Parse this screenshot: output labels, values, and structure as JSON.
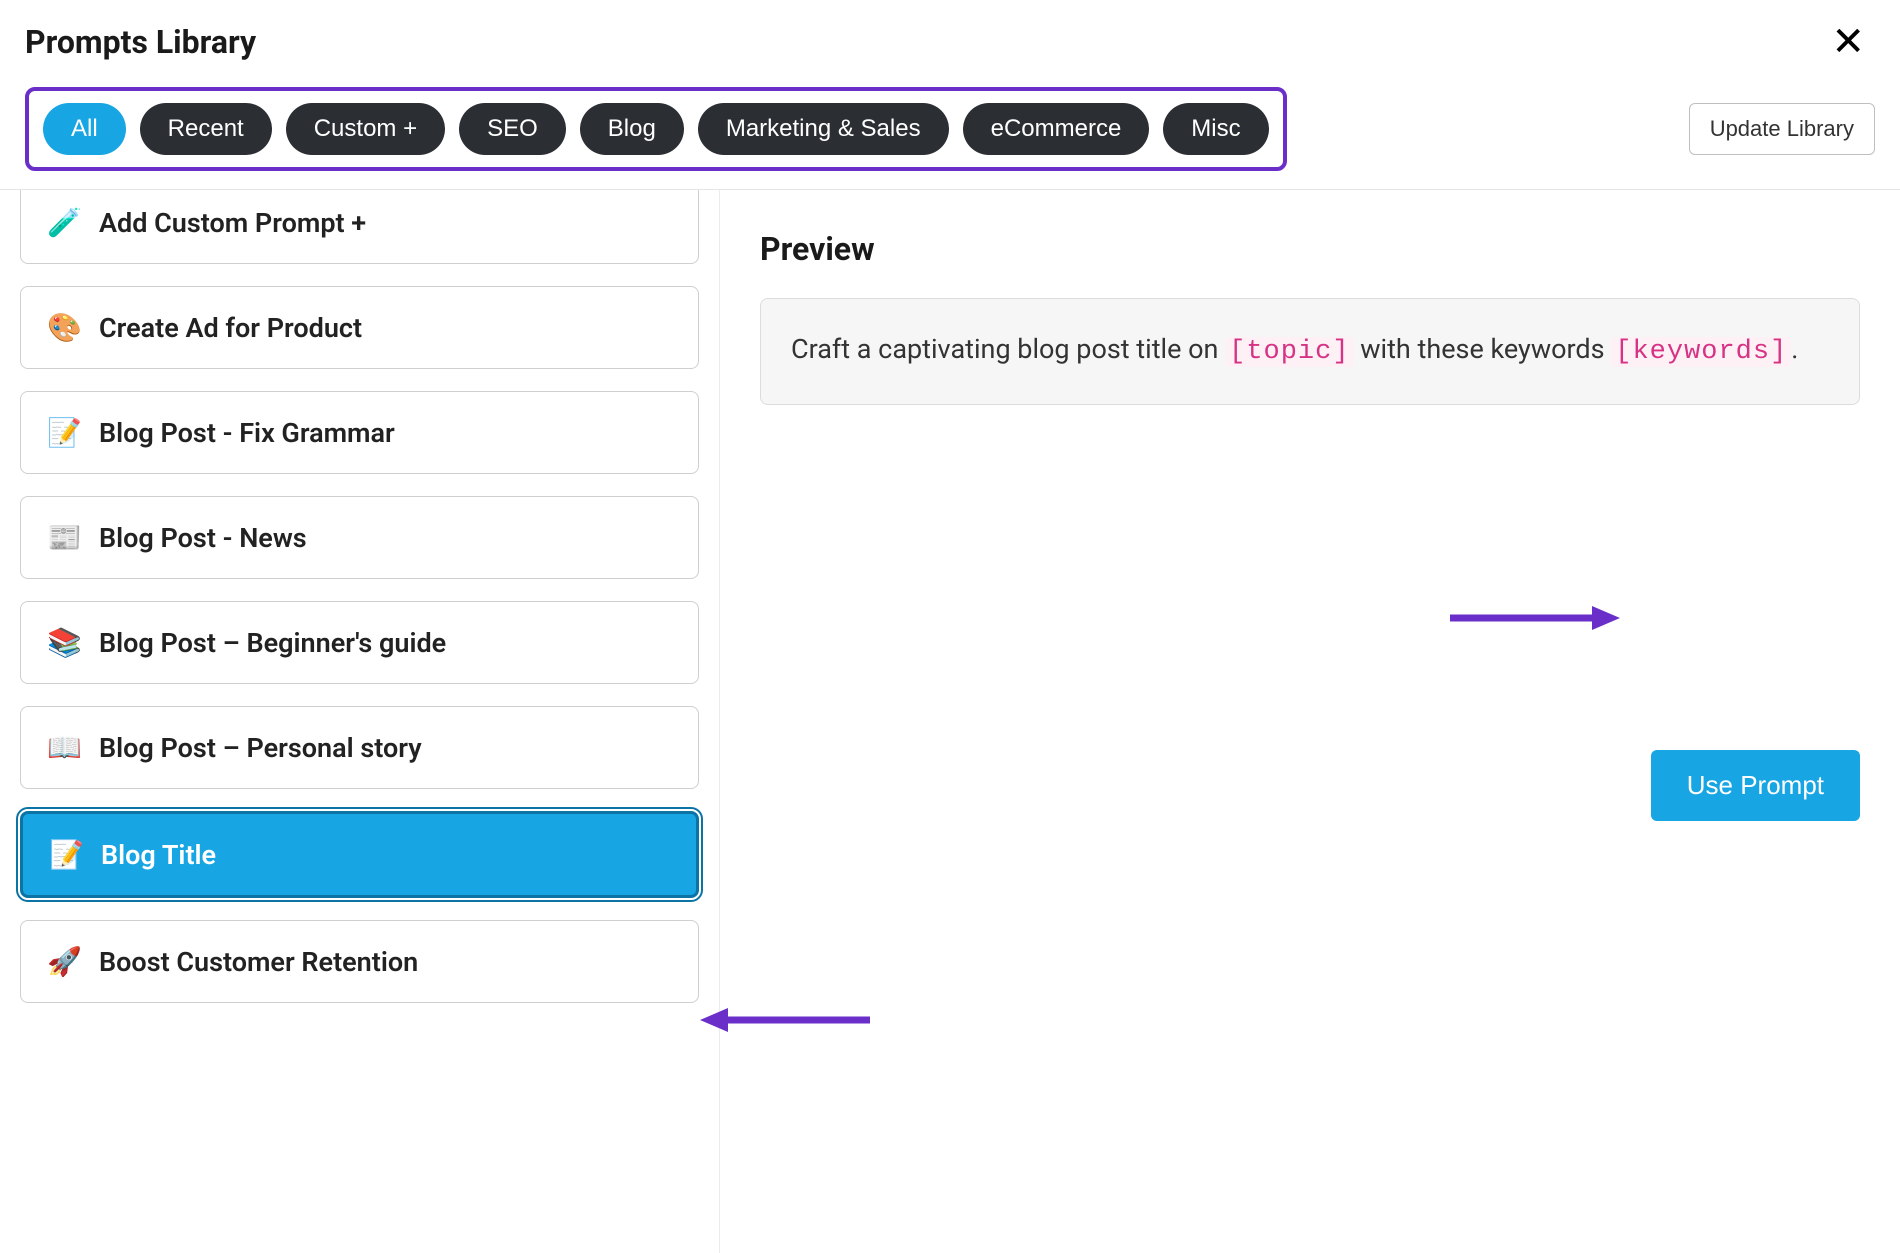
{
  "header": {
    "title": "Prompts Library"
  },
  "filters": {
    "pills": [
      {
        "label": "All",
        "active": true
      },
      {
        "label": "Recent",
        "active": false
      },
      {
        "label": "Custom +",
        "active": false
      },
      {
        "label": "SEO",
        "active": false
      },
      {
        "label": "Blog",
        "active": false
      },
      {
        "label": "Marketing & Sales",
        "active": false
      },
      {
        "label": "eCommerce",
        "active": false
      },
      {
        "label": "Misc",
        "active": false
      }
    ],
    "update_label": "Update Library"
  },
  "prompts": [
    {
      "icon": "🧪",
      "label": "Add Custom Prompt +",
      "selected": false
    },
    {
      "icon": "🎨",
      "label": "Create Ad for Product",
      "selected": false
    },
    {
      "icon": "📝",
      "label": "Blog Post - Fix Grammar",
      "selected": false
    },
    {
      "icon": "📰",
      "label": "Blog Post - News",
      "selected": false
    },
    {
      "icon": "📚",
      "label": "Blog Post – Beginner's guide",
      "selected": false
    },
    {
      "icon": "📖",
      "label": "Blog Post – Personal story",
      "selected": false
    },
    {
      "icon": "📝",
      "label": "Blog Title",
      "selected": true
    },
    {
      "icon": "🚀",
      "label": "Boost Customer Retention",
      "selected": false
    }
  ],
  "preview": {
    "title": "Preview",
    "text_pre": "Craft a captivating blog post title on ",
    "token1": "[topic]",
    "text_mid": " with these keywords ",
    "token2": "[keywords]",
    "text_post": ".",
    "use_label": "Use Prompt"
  },
  "colors": {
    "accent": "#18a5e3",
    "pill_dark": "#2b2f33",
    "highlight_border": "#6a2fc9",
    "token_pink": "#d63384"
  }
}
